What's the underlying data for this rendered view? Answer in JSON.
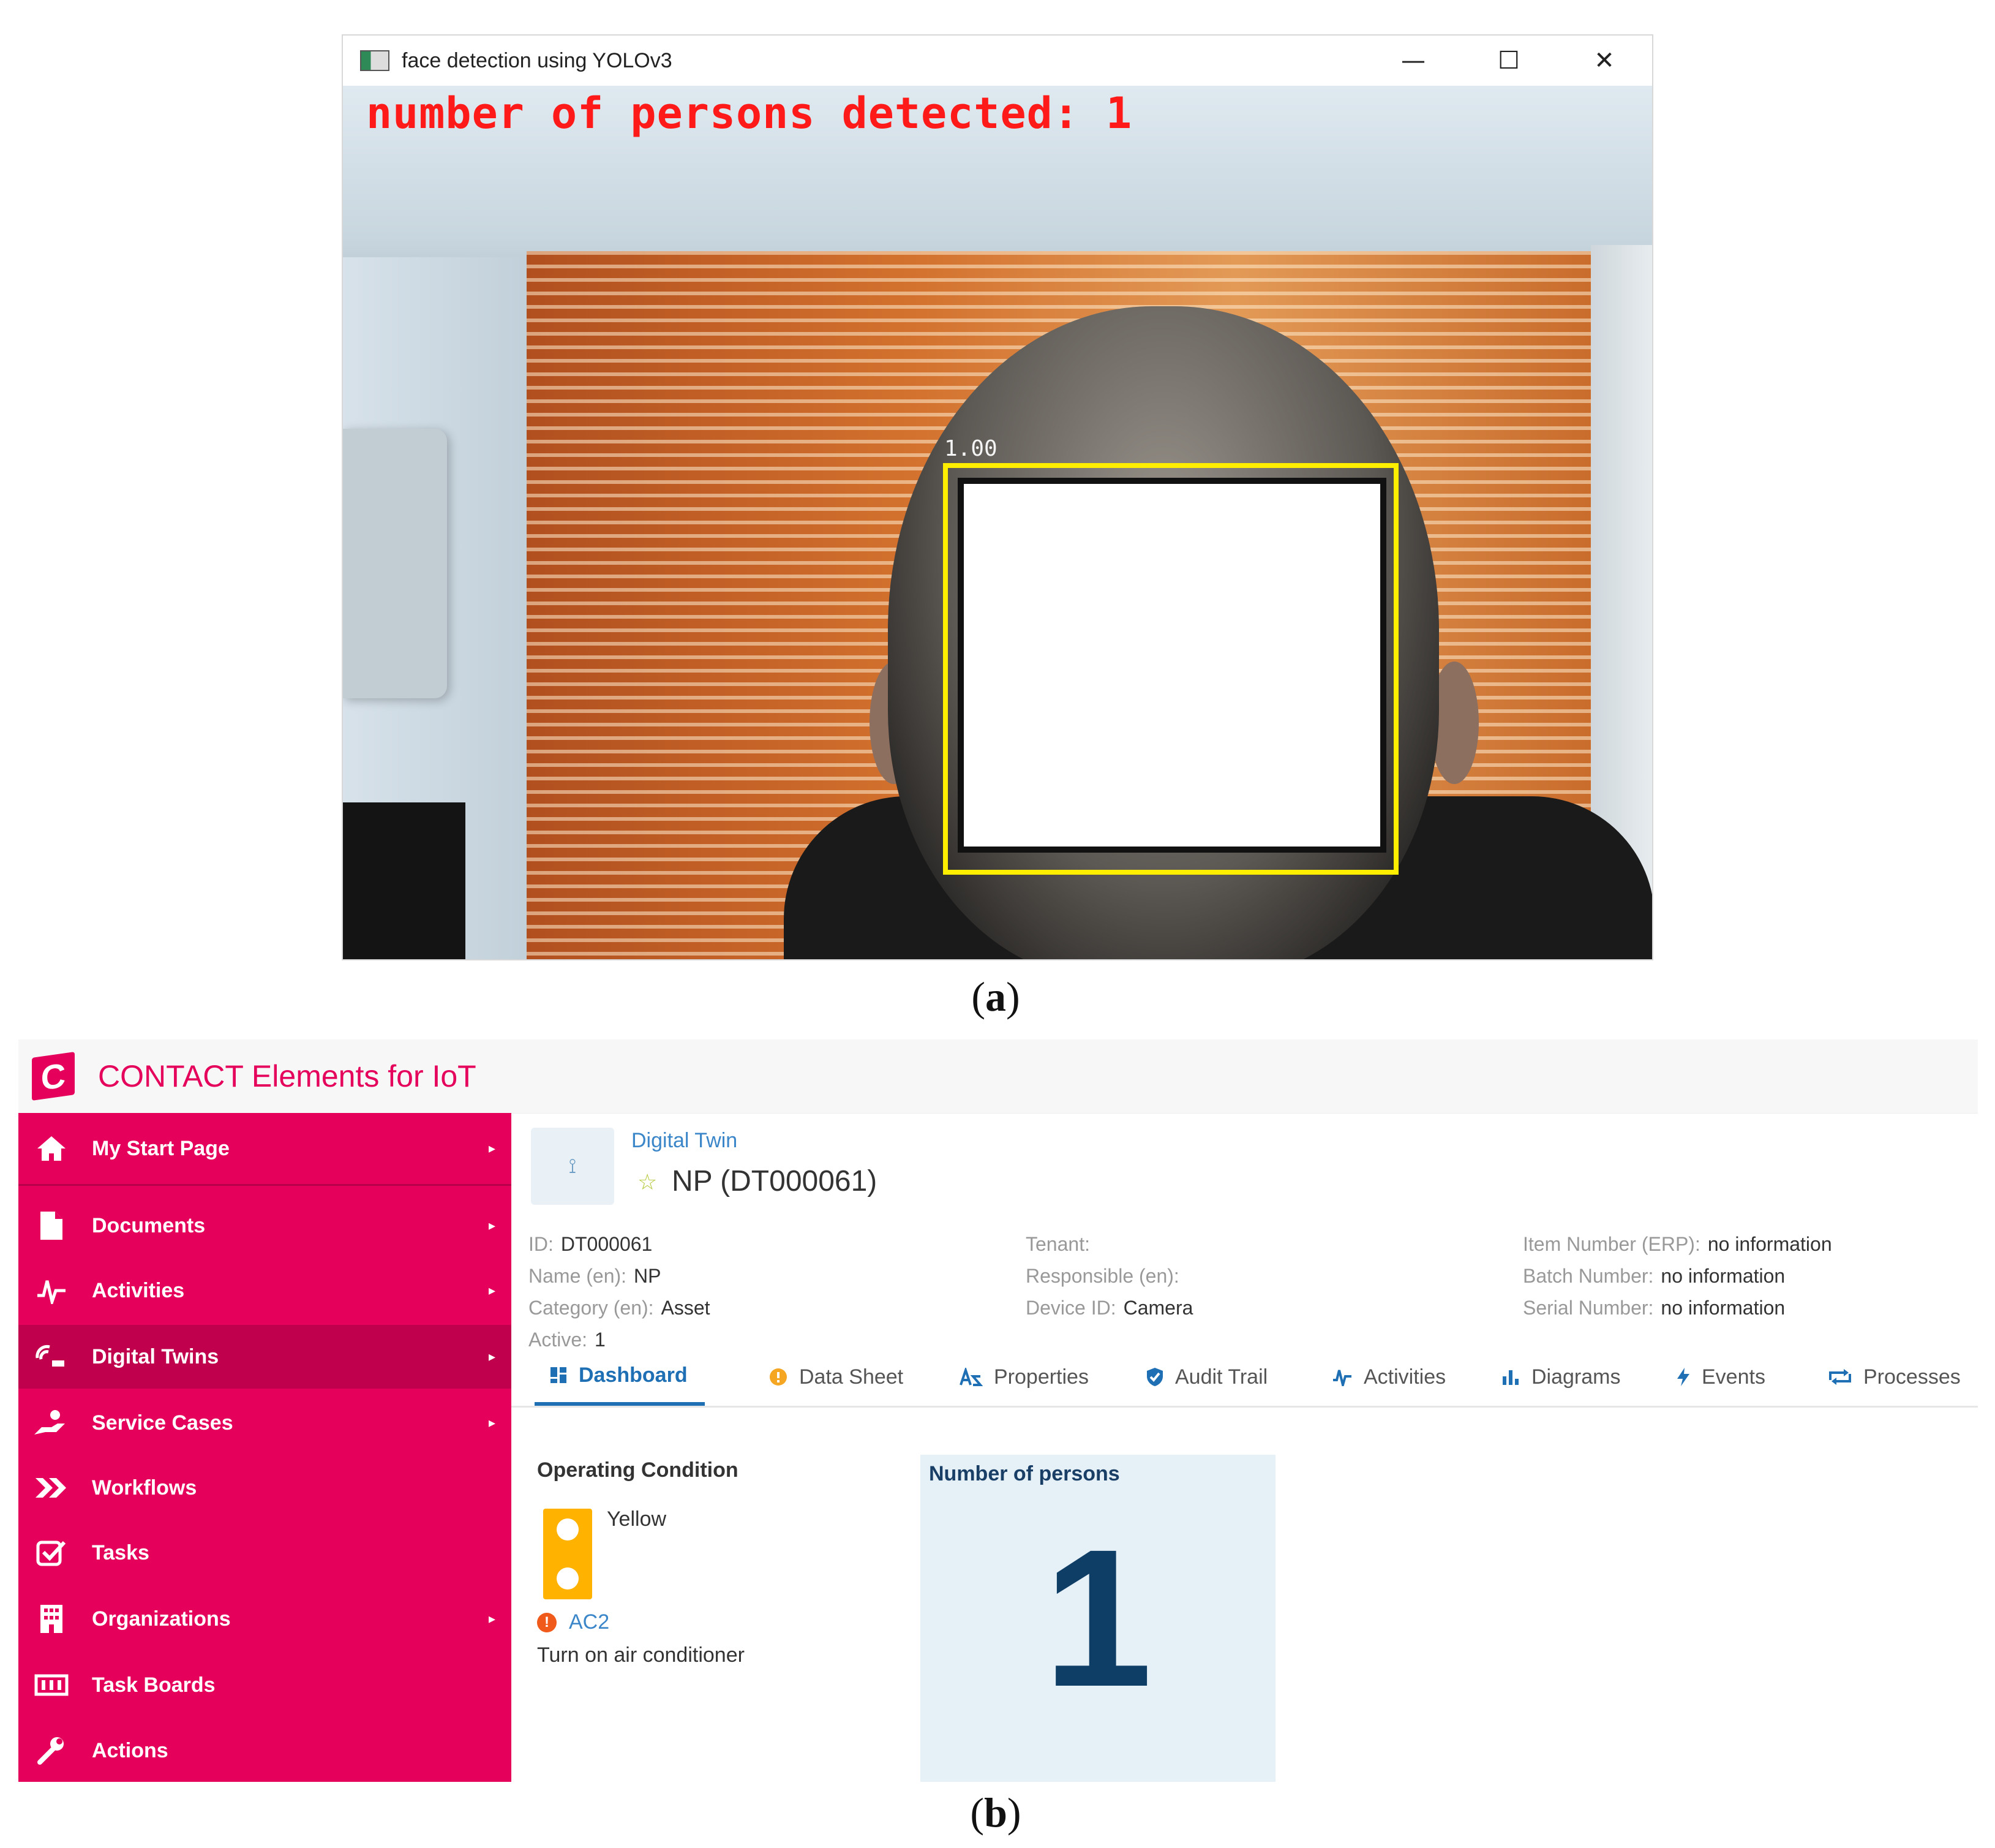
{
  "panel_a": {
    "caption_label": "a",
    "window": {
      "title": "face detection using YOLOv3",
      "minimize_glyph": "—",
      "maximize_glyph": "☐",
      "close_glyph": "✕"
    },
    "overlay_text": "number of persons detected: 1",
    "detection": {
      "score": "1.00",
      "box_color": "#ffee00"
    },
    "icons": [
      "app-window-icon",
      "minimize-icon",
      "maximize-icon",
      "close-icon"
    ]
  },
  "panel_b": {
    "caption_label": "b",
    "app": {
      "title": "CONTACT Elements for IoT",
      "logo_letter": "C",
      "brand_color": "#e4005b",
      "accent_color": "#1f6fb4"
    },
    "sidebar": {
      "items": [
        {
          "label": "My Start Page",
          "icon": "home-icon",
          "has_arrow": true
        },
        {
          "label": "Documents",
          "icon": "document-icon",
          "has_arrow": true
        },
        {
          "label": "Activities",
          "icon": "activity-icon",
          "has_arrow": true
        },
        {
          "label": "Digital Twins",
          "icon": "digital-twin-icon",
          "has_arrow": true,
          "active": true
        },
        {
          "label": "Service Cases",
          "icon": "service-hand-icon",
          "has_arrow": true
        },
        {
          "label": "Workflows",
          "icon": "workflow-chevrons-icon",
          "has_arrow": false
        },
        {
          "label": "Tasks",
          "icon": "task-check-icon",
          "has_arrow": false
        },
        {
          "label": "Organizations",
          "icon": "building-icon",
          "has_arrow": true
        },
        {
          "label": "Task Boards",
          "icon": "task-board-icon",
          "has_arrow": false
        },
        {
          "label": "Actions",
          "icon": "wrench-icon",
          "has_arrow": false
        }
      ],
      "arrow_glyph": "▸"
    },
    "object": {
      "type_link": "Digital Twin",
      "name": "NP (DT000061)",
      "star_glyph": "☆",
      "twin_icon_glyph": "⟟"
    },
    "fields": {
      "col1": [
        {
          "label": "ID:",
          "value": "DT000061"
        },
        {
          "label": "Name (en):",
          "value": "NP"
        },
        {
          "label": "Category (en):",
          "value": "Asset"
        },
        {
          "label": "Active:",
          "value": "1"
        }
      ],
      "col2": [
        {
          "label": "Tenant:",
          "value": ""
        },
        {
          "label": "Responsible (en):",
          "value": ""
        },
        {
          "label": "Device ID:",
          "value": "Camera"
        }
      ],
      "col3": [
        {
          "label": "Item Number (ERP):",
          "value": "no information"
        },
        {
          "label": "Batch Number:",
          "value": "no information"
        },
        {
          "label": "Serial Number:",
          "value": "no information"
        }
      ]
    },
    "tabs": [
      {
        "label": "Dashboard",
        "icon": "dashboard-icon",
        "active": true
      },
      {
        "label": "Data Sheet",
        "icon": "data-sheet-icon"
      },
      {
        "label": "Properties",
        "icon": "properties-icon"
      },
      {
        "label": "Audit Trail",
        "icon": "shield-check-icon"
      },
      {
        "label": "Activities",
        "icon": "activity-icon"
      },
      {
        "label": "Diagrams",
        "icon": "bar-chart-icon"
      },
      {
        "label": "Events",
        "icon": "lightning-icon"
      },
      {
        "label": "Processes",
        "icon": "process-loop-icon"
      }
    ],
    "dashboard": {
      "operating_condition": {
        "title": "Operating Condition",
        "status": "Yellow",
        "status_color": "#ffb300",
        "alert_code": "AC2",
        "alert_icon_glyph": "!",
        "alert_text": "Turn on air conditioner"
      },
      "kpi": {
        "title": "Number of persons",
        "value": "1"
      }
    }
  }
}
